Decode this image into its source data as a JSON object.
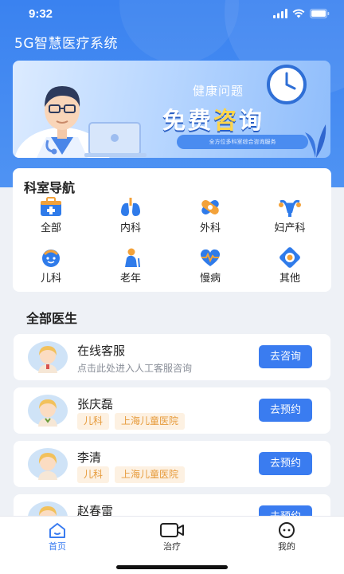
{
  "status_bar": {
    "time": "9:32"
  },
  "app": {
    "title": "5G智慧医疗系统"
  },
  "banner": {
    "subtitle": "健康问题",
    "headline_part1": "免费",
    "headline_highlight": "咨",
    "headline_part2": "询",
    "caption": "全方位多科室综合咨询服务"
  },
  "departments": {
    "title": "科室导航",
    "items": [
      {
        "label": "全部",
        "icon": "medical-kit-icon"
      },
      {
        "label": "内科",
        "icon": "lungs-icon"
      },
      {
        "label": "外科",
        "icon": "bandage-icon"
      },
      {
        "label": "妇产科",
        "icon": "uterus-icon"
      },
      {
        "label": "儿科",
        "icon": "child-face-icon"
      },
      {
        "label": "老年",
        "icon": "elderly-icon"
      },
      {
        "label": "慢病",
        "icon": "heartbeat-icon"
      },
      {
        "label": "其他",
        "icon": "other-icon"
      }
    ]
  },
  "doctors": {
    "title": "全部医生",
    "list": [
      {
        "name": "在线客服",
        "description": "点击此处进入人工客服咨询",
        "tags": [],
        "button": "去咨询"
      },
      {
        "name": "张庆磊",
        "description": "",
        "tags": [
          "儿科",
          "上海儿童医院"
        ],
        "button": "去预约"
      },
      {
        "name": "李清",
        "description": "",
        "tags": [
          "儿科",
          "上海儿童医院"
        ],
        "button": "去预约"
      },
      {
        "name": "赵春雷",
        "description": "",
        "tags": [],
        "button": "去预约"
      }
    ]
  },
  "tabbar": {
    "items": [
      {
        "label": "首页",
        "icon": "home-icon",
        "active": true
      },
      {
        "label": "治疗",
        "icon": "video-camera-icon",
        "active": false
      },
      {
        "label": "我的",
        "icon": "profile-icon",
        "active": false
      }
    ]
  },
  "colors": {
    "primary": "#3a7cf0",
    "tag_text": "#e69a3a",
    "tag_bg": "#fdf1e2"
  }
}
